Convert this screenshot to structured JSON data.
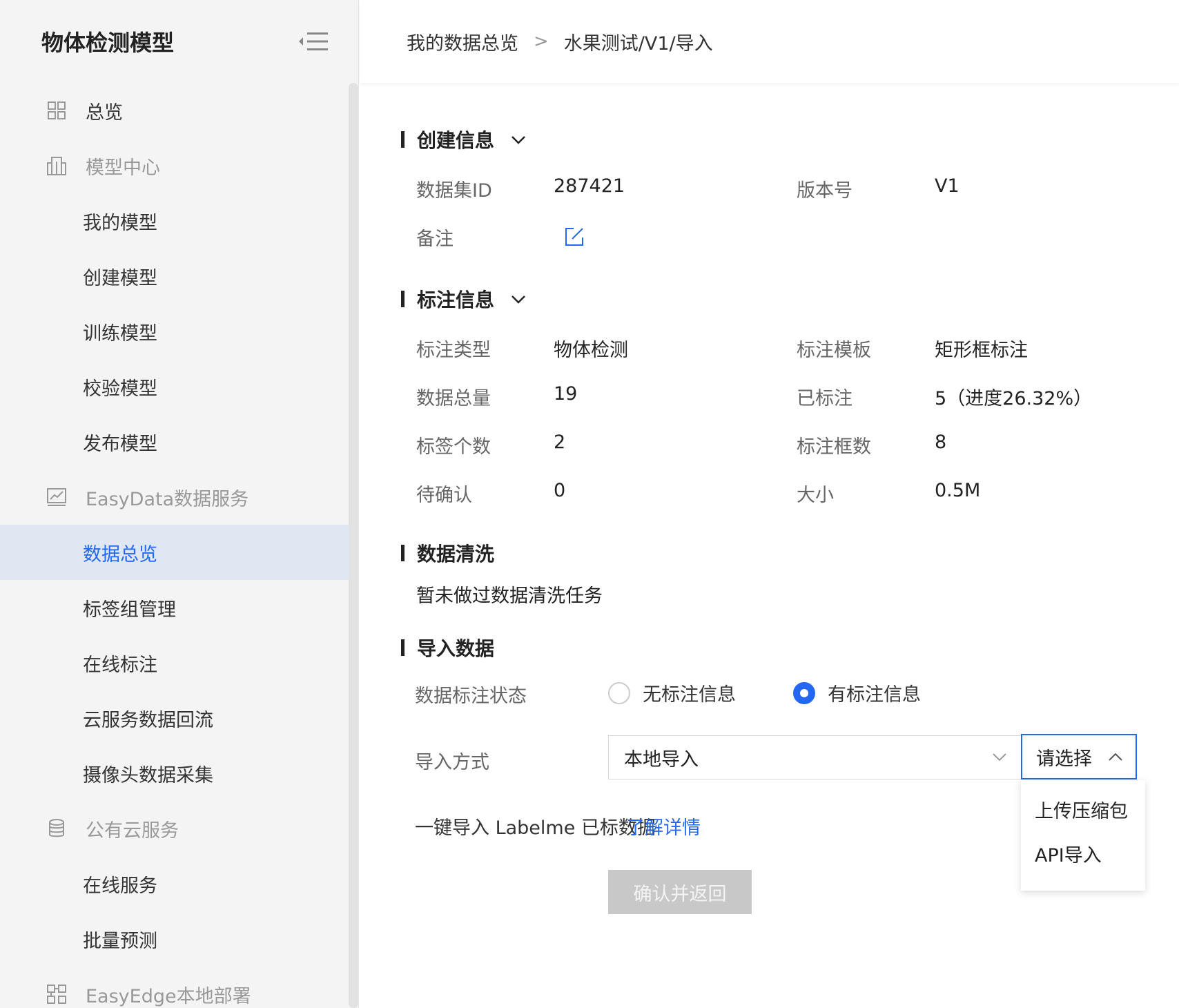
{
  "sidebar": {
    "title": "物体检测模型",
    "items": [
      {
        "label": "总览",
        "kind": "top",
        "icon": "grid-icon"
      },
      {
        "label": "模型中心",
        "kind": "group",
        "icon": "building-icon"
      },
      {
        "label": "我的模型",
        "kind": "sub"
      },
      {
        "label": "创建模型",
        "kind": "sub"
      },
      {
        "label": "训练模型",
        "kind": "sub"
      },
      {
        "label": "校验模型",
        "kind": "sub"
      },
      {
        "label": "发布模型",
        "kind": "sub"
      },
      {
        "label": "EasyData数据服务",
        "kind": "group",
        "icon": "chart-icon"
      },
      {
        "label": "数据总览",
        "kind": "sub",
        "active": true
      },
      {
        "label": "标签组管理",
        "kind": "sub"
      },
      {
        "label": "在线标注",
        "kind": "sub"
      },
      {
        "label": "云服务数据回流",
        "kind": "sub"
      },
      {
        "label": "摄像头数据采集",
        "kind": "sub"
      },
      {
        "label": "公有云服务",
        "kind": "group",
        "icon": "database-icon"
      },
      {
        "label": "在线服务",
        "kind": "sub"
      },
      {
        "label": "批量预测",
        "kind": "sub"
      },
      {
        "label": "EasyEdge本地部署",
        "kind": "group",
        "icon": "deploy-icon"
      }
    ]
  },
  "breadcrumb": {
    "root": "我的数据总览",
    "separator": ">",
    "current": "水果测试/V1/导入"
  },
  "create_info": {
    "title": "创建信息",
    "dataset_id_label": "数据集ID",
    "dataset_id": "287421",
    "version_label": "版本号",
    "version": "V1",
    "note_label": "备注"
  },
  "annotation_info": {
    "title": "标注信息",
    "type_label": "标注类型",
    "type": "物体检测",
    "template_label": "标注模板",
    "template": "矩形框标注",
    "total_label": "数据总量",
    "total": "19",
    "annotated_label": "已标注",
    "annotated": "5（进度26.32%）",
    "tags_label": "标签个数",
    "tags": "2",
    "boxes_label": "标注框数",
    "boxes": "8",
    "pending_label": "待确认",
    "pending": "0",
    "size_label": "大小",
    "size": "0.5M"
  },
  "data_clean": {
    "title": "数据清洗",
    "text": "暂未做过数据清洗任务"
  },
  "import": {
    "title": "导入数据",
    "status_label": "数据标注状态",
    "option_none": "无标注信息",
    "option_has": "有标注信息",
    "method_label": "导入方式",
    "method_value": "本地导入",
    "sub_placeholder": "请选择",
    "dropdown": [
      "上传压缩包",
      "API导入"
    ],
    "labelme_text": "一键导入 Labelme 已标数据",
    "learn_more": "了解详情",
    "confirm": "确认并返回"
  },
  "colors": {
    "accent": "#2468f2",
    "sidebar_bg": "#f4f4f4",
    "active_bg": "#dfe7f3"
  }
}
